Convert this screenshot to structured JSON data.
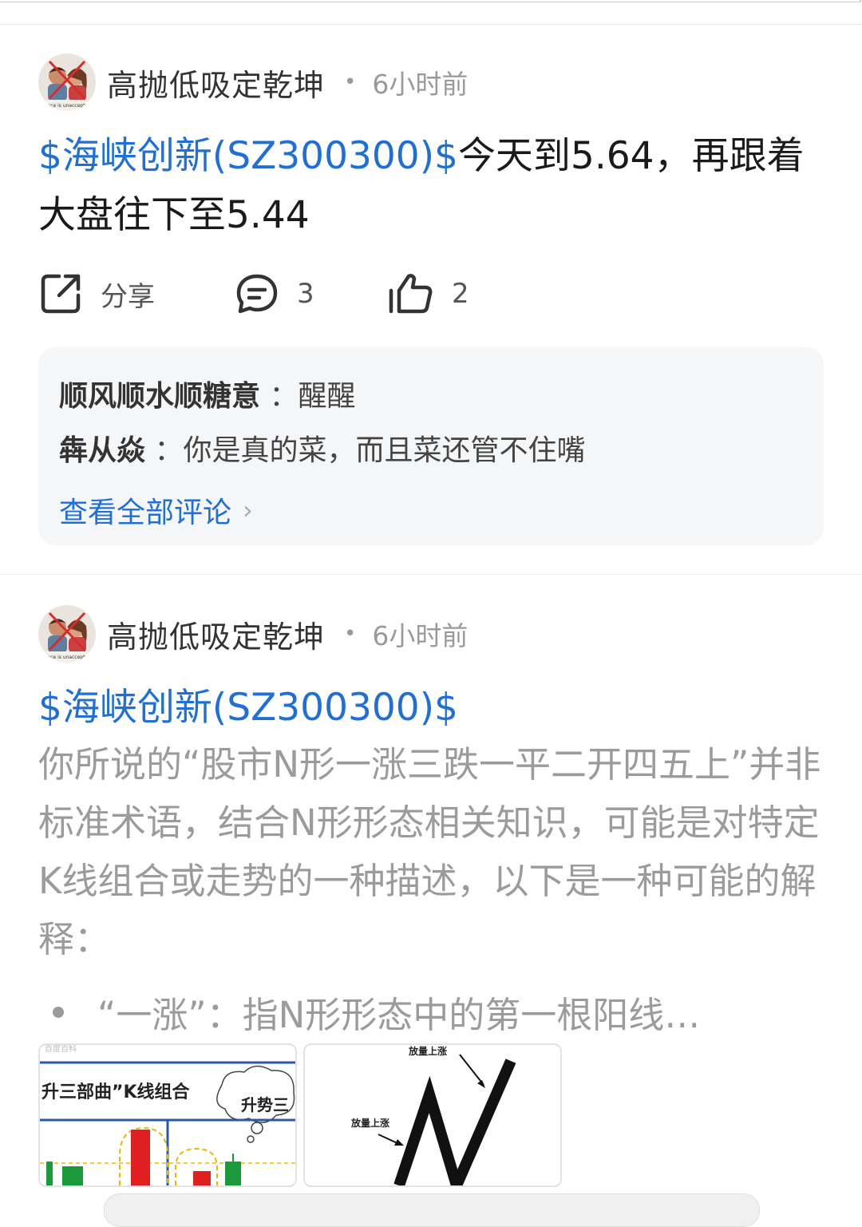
{
  "posts": [
    {
      "author": "高抛低吸定乾坤",
      "time": "6小时前",
      "stock_link": "$海峡创新(SZ300300)$",
      "headline_rest": "今天到5.64，再跟着大盘往下至5.44",
      "actions": {
        "share": "分享",
        "comments": "3",
        "likes": "2"
      },
      "comments": [
        {
          "author": "顺风顺水顺糖意",
          "sep": "：",
          "text": "醒醒"
        },
        {
          "author": "犇从焱",
          "sep": "：",
          "text": "你是真的菜，而且菜还管不住嘴"
        }
      ],
      "view_all": "查看全部评论",
      "avatar_caption": "Silence is unacceptable"
    },
    {
      "author": "高抛低吸定乾坤",
      "time": "6小时前",
      "stock_link": "$海峡创新(SZ300300)$",
      "body": "你所说的“股市N形一涨三跌一平二开四五上”并非标准术语，结合N形形态相关知识，可能是对特定K线组合或走势的一种描述，以下是一种可能的解释：",
      "bullet": "“一涨”：指N形形态中的第一根阳线…",
      "avatar_caption": "Silence is unacceptable",
      "images": [
        {
          "top_text": "百度百科",
          "title": "升三部曲”K线组合",
          "bubble": "升势三"
        },
        {
          "label_top": "放量上涨",
          "label_left": "放量上涨"
        }
      ]
    }
  ],
  "colors": {
    "link": "#1f6fd6",
    "muted": "#9b9b9b",
    "card_bg": "#f5f6f8"
  }
}
